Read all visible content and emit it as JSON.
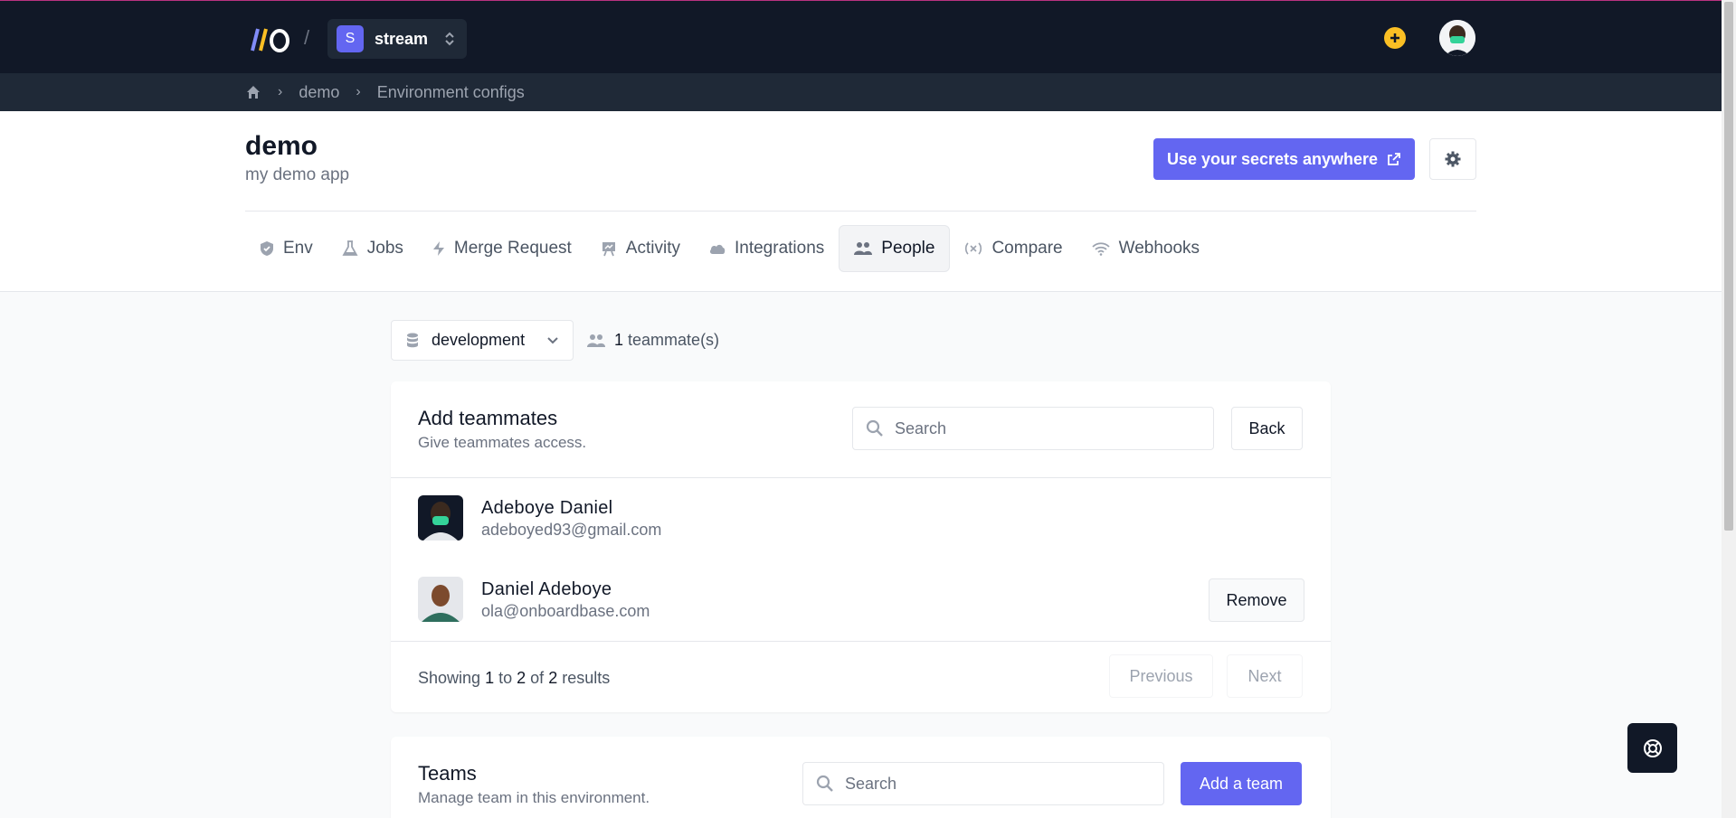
{
  "topbar": {
    "logo_text": "//O",
    "separator": "/",
    "project": {
      "initial": "S",
      "name": "stream"
    }
  },
  "breadcrumb": [
    "demo",
    "Environment configs"
  ],
  "app": {
    "title": "demo",
    "subtitle": "my demo app",
    "secrets_button": "Use your secrets anywhere"
  },
  "tabs": [
    {
      "label": "Env",
      "icon": "shield-icon"
    },
    {
      "label": "Jobs",
      "icon": "flask-icon"
    },
    {
      "label": "Merge Request",
      "icon": "bolt-icon"
    },
    {
      "label": "Activity",
      "icon": "presentation-icon"
    },
    {
      "label": "Integrations",
      "icon": "cloud-icon"
    },
    {
      "label": "People",
      "icon": "users-icon",
      "active": true
    },
    {
      "label": "Compare",
      "icon": "variable-icon"
    },
    {
      "label": "Webhooks",
      "icon": "wifi-icon"
    }
  ],
  "environment": {
    "selected": "development"
  },
  "teammates_count": {
    "count": "1",
    "label": "teammate(s)"
  },
  "add_teammates": {
    "title": "Add teammates",
    "subtitle": "Give teammates access.",
    "search_placeholder": "Search",
    "back_button": "Back",
    "members": [
      {
        "name": "Adeboye Daniel",
        "email": "adeboyed93@gmail.com",
        "removable": false
      },
      {
        "name": "Daniel Adeboye",
        "email": "ola@onboardbase.com",
        "removable": true,
        "remove_label": "Remove"
      }
    ],
    "results": {
      "prefix": "Showing",
      "from": "1",
      "to_word": "to",
      "to": "2",
      "of_word": "of",
      "total": "2",
      "suffix": "results"
    },
    "previous_button": "Previous",
    "next_button": "Next"
  },
  "teams": {
    "title": "Teams",
    "subtitle": "Manage team in this environment.",
    "search_placeholder": "Search",
    "add_button": "Add a team"
  },
  "colors": {
    "accent": "#6366f1",
    "topbar": "#111827",
    "plus": "#fbbf24"
  }
}
